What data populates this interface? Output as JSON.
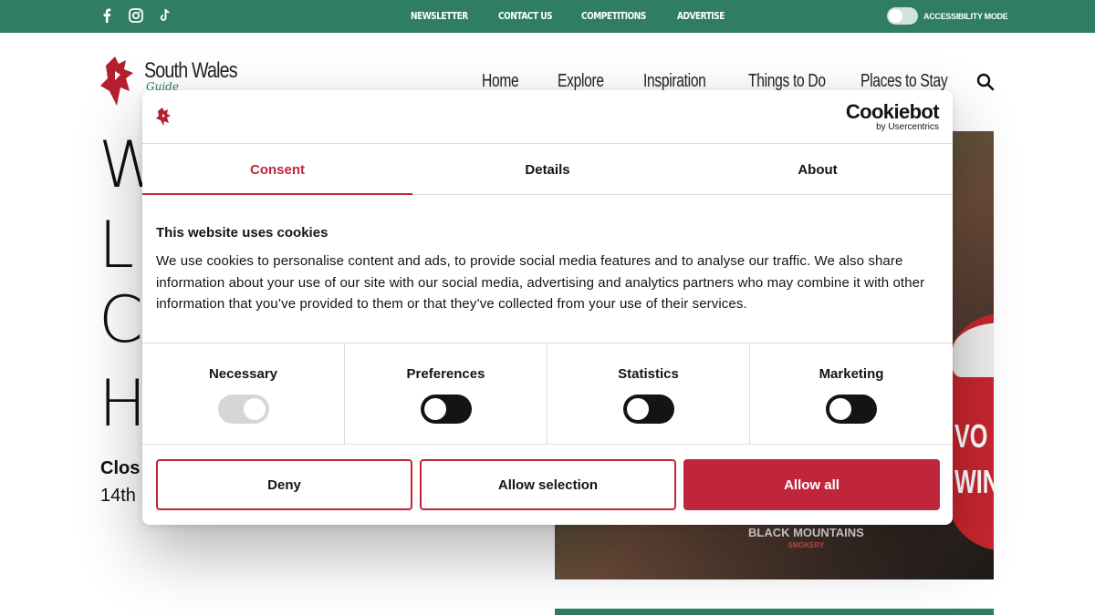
{
  "topbar": {
    "social_icons": [
      "facebook-icon",
      "instagram-icon",
      "tiktok-icon"
    ],
    "links": [
      "NEWSLETTER",
      "CONTACT US",
      "COMPETITIONS",
      "ADVERTISE"
    ],
    "accessibility_label": "ACCESSIBILITY MODE",
    "accessibility_on": false
  },
  "header": {
    "logo_title": "South Wales",
    "logo_subtitle": "Guide",
    "nav": [
      "Home",
      "Explore",
      "Inspiration",
      "Things to Do",
      "Places to Stay"
    ]
  },
  "page": {
    "hero_letters": [
      "W",
      "L",
      "C",
      "Ha"
    ],
    "closing_label": "Clos",
    "closing_date": "14th",
    "photo_text": [
      "VO",
      "WIN"
    ],
    "photo_brand": "BLACK MOUNTAINS",
    "photo_brand_sub": "SMOKERY"
  },
  "dialog": {
    "brand_name": "Cookiebot",
    "brand_sub": "by Usercentrics",
    "tabs": [
      {
        "label": "Consent",
        "active": true
      },
      {
        "label": "Details",
        "active": false
      },
      {
        "label": "About",
        "active": false
      }
    ],
    "title": "This website uses cookies",
    "text": "We use cookies to personalise content and ads, to provide social media features and to analyse our traffic. We also share information about your use of our site with our social media, advertising and analytics partners who may combine it with other information that you’ve provided to them or that they’ve collected from your use of their services.",
    "categories": [
      {
        "label": "Necessary",
        "state": "on-disabled"
      },
      {
        "label": "Preferences",
        "state": "off"
      },
      {
        "label": "Statistics",
        "state": "off"
      },
      {
        "label": "Marketing",
        "state": "off"
      }
    ],
    "buttons": {
      "deny": "Deny",
      "allow_selection": "Allow selection",
      "allow_all": "Allow all"
    }
  },
  "colors": {
    "brand_green": "#2e7d64",
    "consent_red": "#c0263b",
    "toggle_off": "#141414"
  }
}
